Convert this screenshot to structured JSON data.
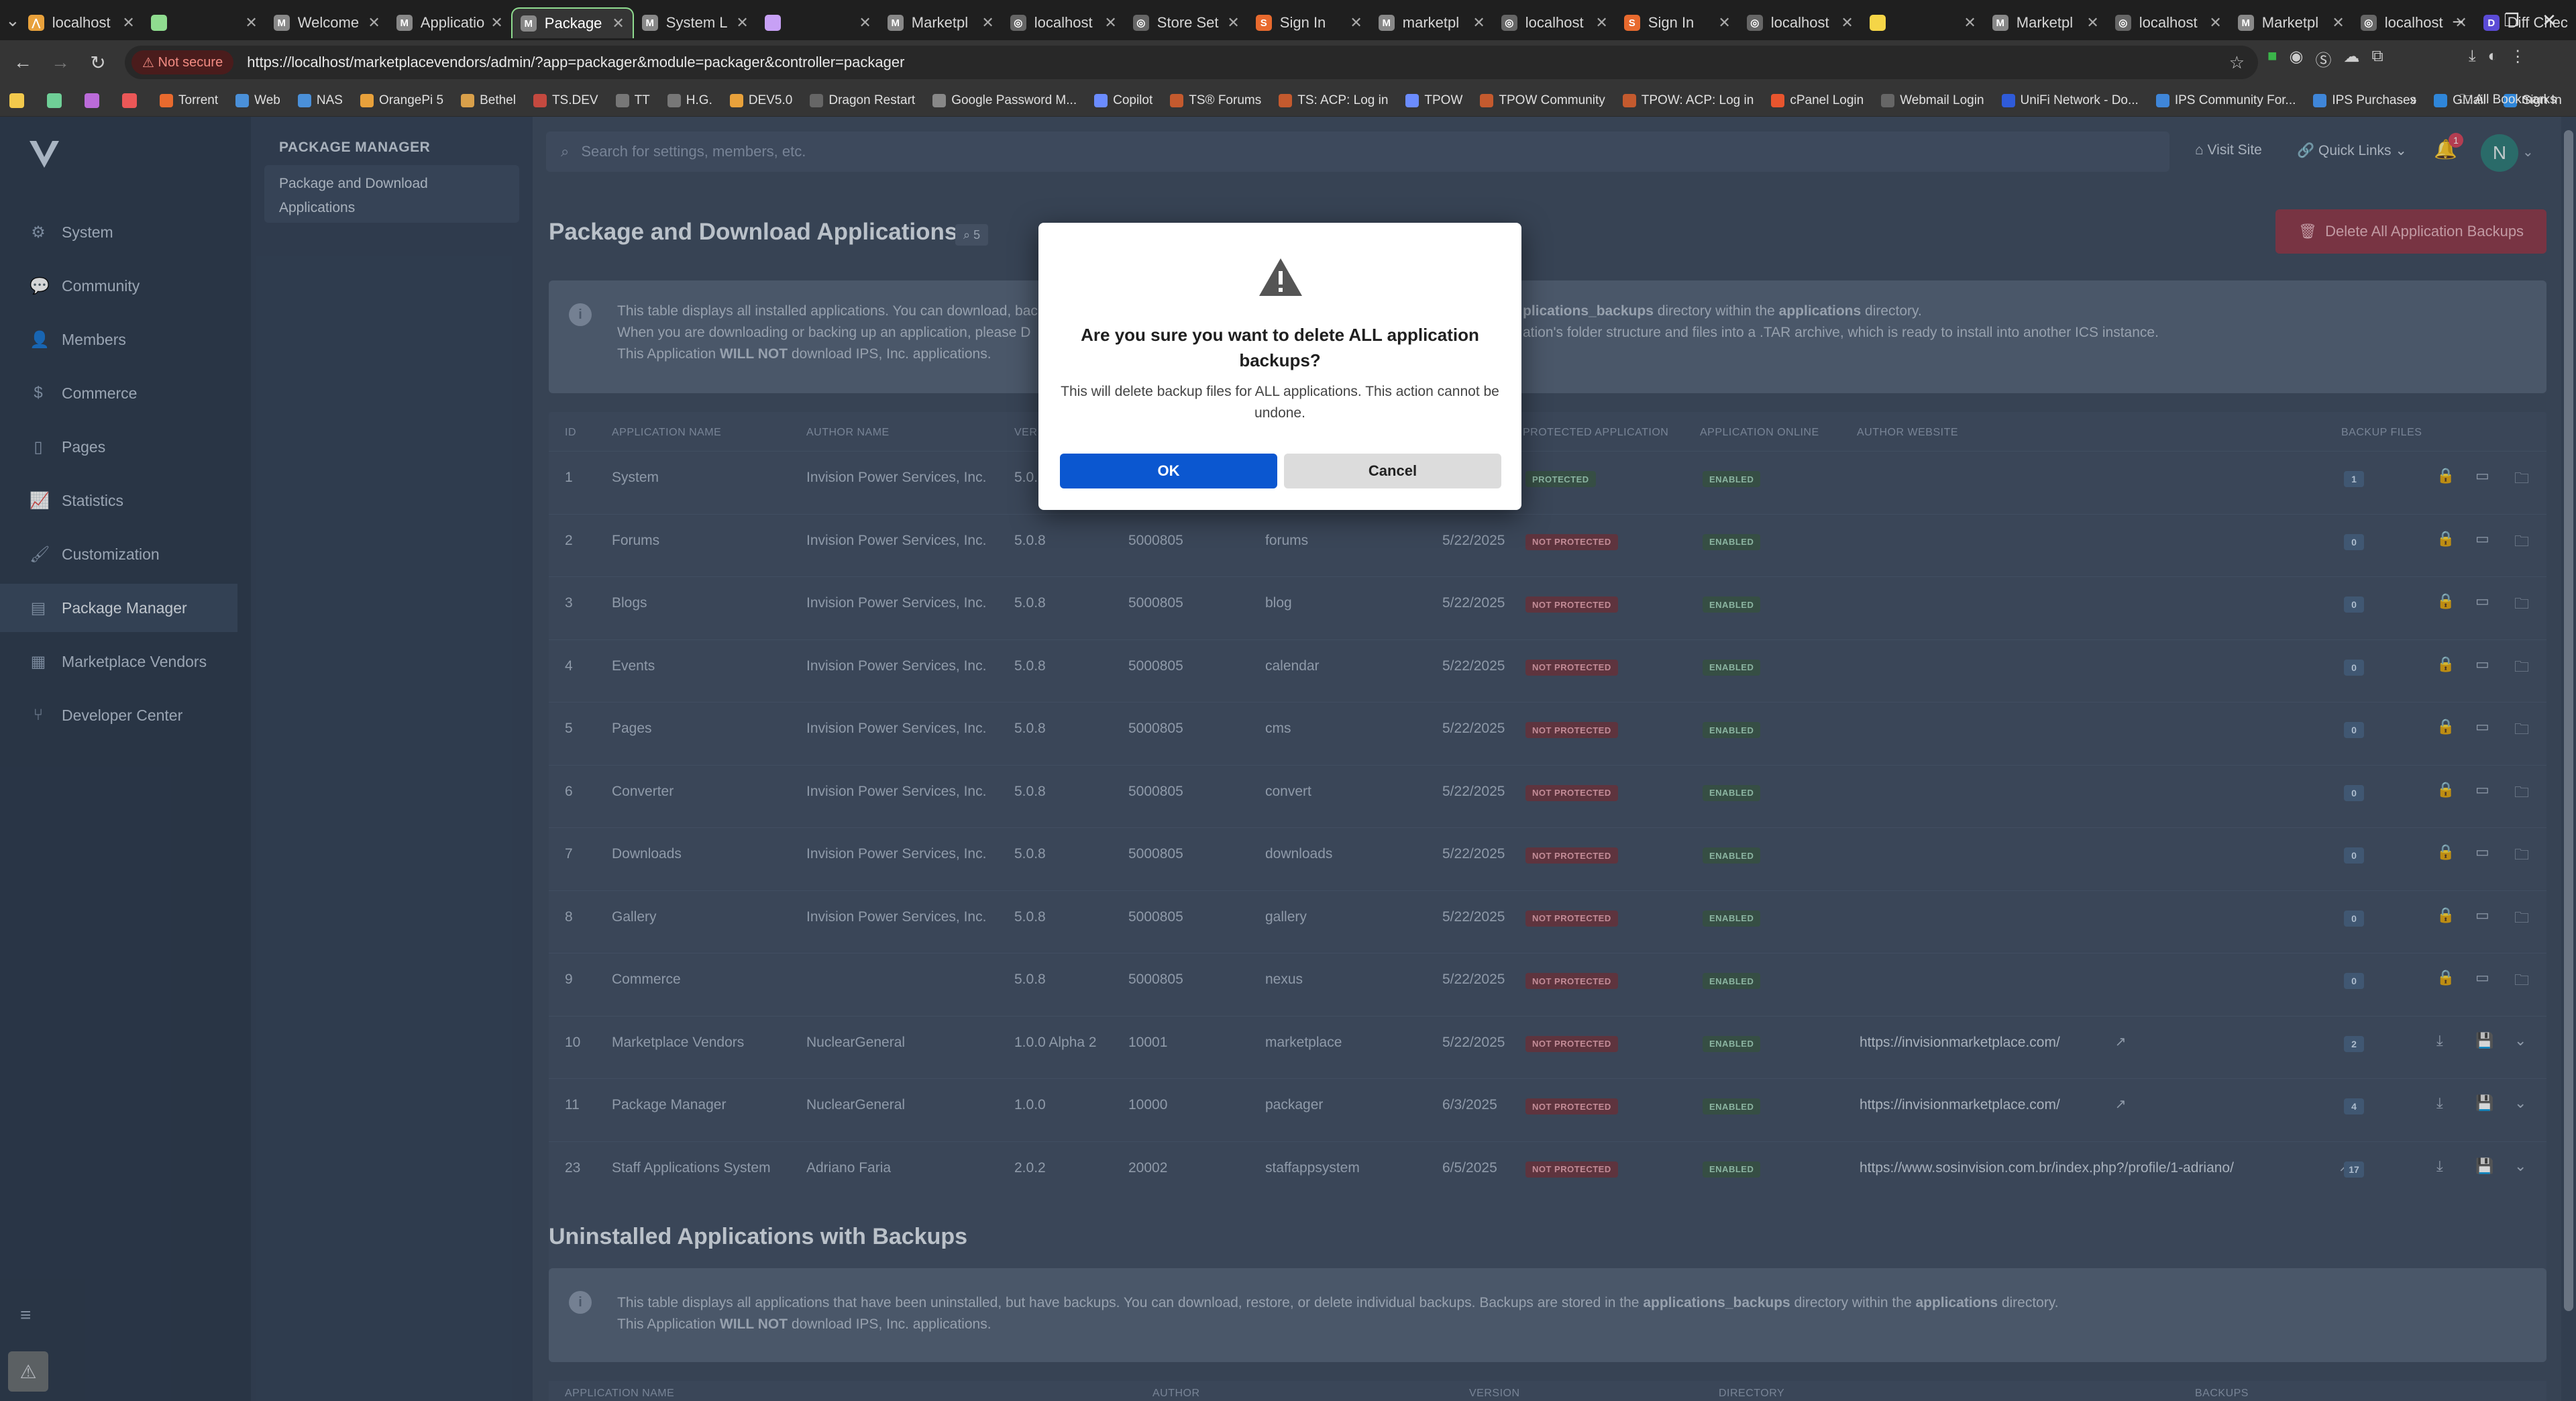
{
  "browser": {
    "tabs": [
      {
        "title": "localhost",
        "fav": "#e8a13b",
        "letter": "⋀"
      },
      {
        "title": "",
        "fav": "#8fdc8f",
        "letter": ""
      },
      {
        "title": "Welcome",
        "fav": "#888",
        "letter": "M"
      },
      {
        "title": "Applicatio",
        "fav": "#888",
        "letter": "M"
      },
      {
        "title": "Package",
        "fav": "#888",
        "letter": "M"
      },
      {
        "title": "System L",
        "fav": "#888",
        "letter": "M"
      },
      {
        "title": "",
        "fav": "#c7a0f5",
        "letter": ""
      },
      {
        "title": "Marketpl",
        "fav": "#888",
        "letter": "M"
      },
      {
        "title": "localhost",
        "fav": "#666",
        "letter": "◎"
      },
      {
        "title": "Store Set",
        "fav": "#666",
        "letter": "◎"
      },
      {
        "title": "Sign In",
        "fav": "#e86a2e",
        "letter": "S"
      },
      {
        "title": "marketpl",
        "fav": "#888",
        "letter": "M"
      },
      {
        "title": "localhost",
        "fav": "#666",
        "letter": "◎"
      },
      {
        "title": "Sign In",
        "fav": "#e86a2e",
        "letter": "S"
      },
      {
        "title": "localhost",
        "fav": "#666",
        "letter": "◎"
      },
      {
        "title": "",
        "fav": "#f5d547",
        "letter": ""
      },
      {
        "title": "Marketpl",
        "fav": "#888",
        "letter": "M"
      },
      {
        "title": "localhost",
        "fav": "#666",
        "letter": "◎"
      },
      {
        "title": "Marketpl",
        "fav": "#888",
        "letter": "M"
      },
      {
        "title": "localhost",
        "fav": "#666",
        "letter": "◎"
      },
      {
        "title": "Diff Chec",
        "fav": "#5b4bd6",
        "letter": "D"
      }
    ],
    "not_secure": "Not secure",
    "url": "https://localhost/marketplacevendors/admin/?app=packager&module=packager&controller=packager",
    "bookmarks": [
      "Torrent",
      "Web",
      "NAS",
      "OrangePi 5",
      "Bethel",
      "TS.DEV",
      "TT",
      "H.G.",
      "DEV5.0",
      "Dragon Restart",
      "Google Password M...",
      "Copilot",
      "TS® Forums",
      "TS: ACP: Log in",
      "TPOW",
      "TPOW Community",
      "TPOW: ACP: Log in",
      "cPanel Login",
      "Webmail Login",
      "UniFi Network - Do...",
      "IPS Community For...",
      "IPS Purchases",
      "GMail",
      "Sign In"
    ],
    "all_bookmarks": "All Bookmarks"
  },
  "sidebar": {
    "items": [
      {
        "label": "System",
        "icon": "⚙"
      },
      {
        "label": "Community",
        "icon": "💬"
      },
      {
        "label": "Members",
        "icon": "👤"
      },
      {
        "label": "Commerce",
        "icon": "$"
      },
      {
        "label": "Pages",
        "icon": "▯"
      },
      {
        "label": "Statistics",
        "icon": "📈"
      },
      {
        "label": "Customization",
        "icon": "🖌"
      },
      {
        "label": "Package Manager",
        "icon": "▤"
      },
      {
        "label": "Marketplace Vendors",
        "icon": "▦"
      },
      {
        "label": "Developer Center",
        "icon": "⑂"
      }
    ]
  },
  "subnav": {
    "heading": "PACKAGE MANAGER",
    "item_line1": "Package and Download",
    "item_line2": "Applications"
  },
  "header": {
    "search_placeholder": "Search for settings, members, etc.",
    "visit_site": "Visit Site",
    "quick_links": "Quick Links",
    "notif_count": "1",
    "avatar": "N"
  },
  "page": {
    "title": "Package and Download Applications",
    "count": "5",
    "delete_all": "Delete All Application Backups",
    "info_line1a": "This table displays all installed applications. You can download, bac",
    "info_line1b": "plications_backups",
    "info_line1c": " directory within the ",
    "info_line1d": "applications",
    "info_line1e": " directory.",
    "info_line2a": "When you are downloading or backing up an application, please D",
    "info_line2b": "ation's folder structure and files into a .TAR archive, which is ready to install into another ICS instance.",
    "info_line3a": "This Application ",
    "info_line3b": "WILL NOT",
    "info_line3c": " download IPS, Inc. applications."
  },
  "table": {
    "headers": {
      "id": "ID",
      "name": "APPLICATION NAME",
      "author": "AUTHOR NAME",
      "version": "VER",
      "protected": "PROTECTED APPLICATION",
      "online": "APPLICATION ONLINE",
      "website": "AUTHOR WEBSITE",
      "backups": "BACKUP FILES"
    },
    "rows": [
      {
        "id": "1",
        "name": "System",
        "author": "Invision Power Services, Inc.",
        "version": "5.0.8",
        "long": "",
        "dir": "",
        "date": "",
        "prot": "PROTECTED",
        "online": "ENABLED",
        "website": "",
        "backups": "1",
        "type": "ips"
      },
      {
        "id": "2",
        "name": "Forums",
        "author": "Invision Power Services, Inc.",
        "version": "5.0.8",
        "long": "5000805",
        "dir": "forums",
        "date": "5/22/2025",
        "prot": "NOT PROTECTED",
        "online": "ENABLED",
        "website": "",
        "backups": "0",
        "type": "ips"
      },
      {
        "id": "3",
        "name": "Blogs",
        "author": "Invision Power Services, Inc.",
        "version": "5.0.8",
        "long": "5000805",
        "dir": "blog",
        "date": "5/22/2025",
        "prot": "NOT PROTECTED",
        "online": "ENABLED",
        "website": "",
        "backups": "0",
        "type": "ips"
      },
      {
        "id": "4",
        "name": "Events",
        "author": "Invision Power Services, Inc.",
        "version": "5.0.8",
        "long": "5000805",
        "dir": "calendar",
        "date": "5/22/2025",
        "prot": "NOT PROTECTED",
        "online": "ENABLED",
        "website": "",
        "backups": "0",
        "type": "ips"
      },
      {
        "id": "5",
        "name": "Pages",
        "author": "Invision Power Services, Inc.",
        "version": "5.0.8",
        "long": "5000805",
        "dir": "cms",
        "date": "5/22/2025",
        "prot": "NOT PROTECTED",
        "online": "ENABLED",
        "website": "",
        "backups": "0",
        "type": "ips"
      },
      {
        "id": "6",
        "name": "Converter",
        "author": "Invision Power Services, Inc.",
        "version": "5.0.8",
        "long": "5000805",
        "dir": "convert",
        "date": "5/22/2025",
        "prot": "NOT PROTECTED",
        "online": "ENABLED",
        "website": "",
        "backups": "0",
        "type": "ips"
      },
      {
        "id": "7",
        "name": "Downloads",
        "author": "Invision Power Services, Inc.",
        "version": "5.0.8",
        "long": "5000805",
        "dir": "downloads",
        "date": "5/22/2025",
        "prot": "NOT PROTECTED",
        "online": "ENABLED",
        "website": "",
        "backups": "0",
        "type": "ips"
      },
      {
        "id": "8",
        "name": "Gallery",
        "author": "Invision Power Services, Inc.",
        "version": "5.0.8",
        "long": "5000805",
        "dir": "gallery",
        "date": "5/22/2025",
        "prot": "NOT PROTECTED",
        "online": "ENABLED",
        "website": "",
        "backups": "0",
        "type": "ips"
      },
      {
        "id": "9",
        "name": "Commerce",
        "author": "",
        "version": "5.0.8",
        "long": "5000805",
        "dir": "nexus",
        "date": "5/22/2025",
        "prot": "NOT PROTECTED",
        "online": "ENABLED",
        "website": "",
        "backups": "0",
        "type": "ips"
      },
      {
        "id": "10",
        "name": "Marketplace Vendors",
        "author": "NuclearGeneral",
        "version": "1.0.0 Alpha 2",
        "long": "10001",
        "dir": "marketplace",
        "date": "5/22/2025",
        "prot": "NOT PROTECTED",
        "online": "ENABLED",
        "website": "https://invisionmarketplace.com/",
        "backups": "2",
        "type": "3rd"
      },
      {
        "id": "11",
        "name": "Package Manager",
        "author": "NuclearGeneral",
        "version": "1.0.0",
        "long": "10000",
        "dir": "packager",
        "date": "6/3/2025",
        "prot": "NOT PROTECTED",
        "online": "ENABLED",
        "website": "https://invisionmarketplace.com/",
        "backups": "4",
        "type": "3rd"
      },
      {
        "id": "23",
        "name": "Staff Applications System",
        "author": "Adriano Faria",
        "version": "2.0.2",
        "long": "20002",
        "dir": "staffappsystem",
        "date": "6/5/2025",
        "prot": "NOT PROTECTED",
        "online": "ENABLED",
        "website": "https://www.sosinvision.com.br/index.php?/profile/1-adriano/",
        "backups": "17",
        "type": "3rd"
      }
    ]
  },
  "uninstalled": {
    "title": "Uninstalled Applications with Backups",
    "info1a": "This table displays all applications that have been uninstalled, but have backups. You can download, restore, or delete individual backups. Backups are stored in the ",
    "info1b": "applications_backups",
    "info1c": " directory within the ",
    "info1d": "applications",
    "info1e": " directory.",
    "info2a": "This Application ",
    "info2b": "WILL NOT",
    "info2c": " download IPS, Inc. applications.",
    "headers": {
      "name": "APPLICATION NAME",
      "author": "AUTHOR",
      "version": "VERSION",
      "directory": "DIRECTORY",
      "backups": "BACKUPS"
    }
  },
  "modal": {
    "title_line1": "Are you sure you want to delete ALL application",
    "title_line2": "backups?",
    "body_line1": "This will delete backup files for ALL applications. This action cannot be",
    "body_line2": "undone.",
    "ok": "OK",
    "cancel": "Cancel"
  },
  "colors": {
    "ok_button": "#0b57d0",
    "danger": "#b5364b",
    "sidebar": "#2e3b4e"
  }
}
